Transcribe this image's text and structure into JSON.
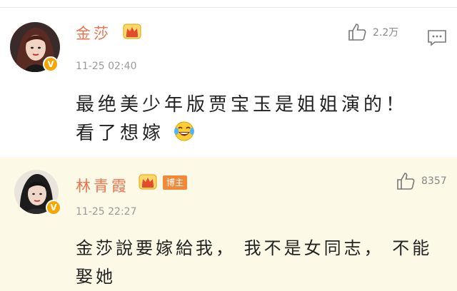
{
  "comments": [
    {
      "username": "金莎",
      "timestamp": "11-25 02:40",
      "likes": "2.2万",
      "text_line1": "最绝美少年版贾宝玉是姐姐演的！",
      "text_line2": "看了想嫁",
      "emoji": "laughing-tears-emoji",
      "verified_badge": "V"
    },
    {
      "username": "林青霞",
      "badge": "博主",
      "timestamp": "11-25 22:27",
      "likes": "8357",
      "text_line1": "金莎說要嫁給我， 我不是女同志， 不能",
      "text_line2": "娶她",
      "verified_badge": "V"
    }
  ],
  "colors": {
    "username": "#eb7350",
    "highlight_bg": "#fcf9e6",
    "verified": "#f7a600",
    "badge_bg": "#f08a3a"
  }
}
